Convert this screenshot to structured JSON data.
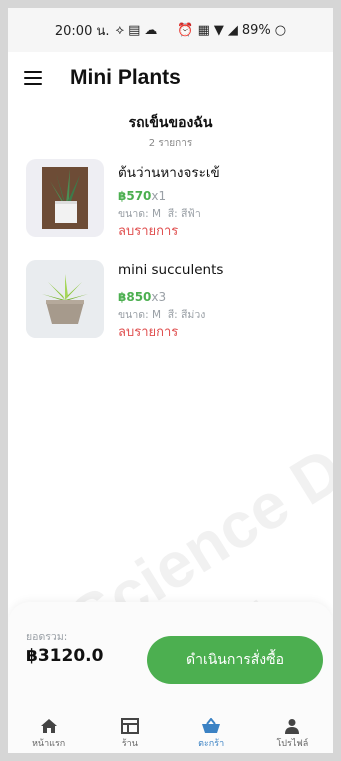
{
  "status_bar": {
    "time": "20:00 น.",
    "battery": "89%"
  },
  "app": {
    "title": "Mini Plants"
  },
  "cart": {
    "title": "รถเข็นของฉัน",
    "count": "2 รายการ",
    "items": [
      {
        "name": "ต้นว่านหางจระเข้",
        "price": "฿570",
        "qty": "x1",
        "size": "ขนาด: M",
        "color": "สี: สีฟ้า",
        "remove_label": "ลบรายการ"
      },
      {
        "name": "mini succulents",
        "price": "฿850",
        "qty": "x3",
        "size": "ขนาด: M",
        "color": "สี: สีม่วง",
        "remove_label": "ลบรายการ"
      }
    ]
  },
  "summary": {
    "total_label": "ยอดรวม:",
    "total_value": "฿3120.0",
    "checkout_label": "ดำเนินการสั่งซื้อ"
  },
  "nav": {
    "items": [
      {
        "label": "หน้าแรก",
        "icon": "home-icon"
      },
      {
        "label": "ร้าน",
        "icon": "store-icon"
      },
      {
        "label": "ตะกร้า",
        "icon": "basket-icon"
      },
      {
        "label": "โปรไฟล์",
        "icon": "profile-icon"
      }
    ],
    "active_color": "#3b82c4"
  },
  "colors": {
    "accent": "#4caf50",
    "danger": "#e05050"
  }
}
